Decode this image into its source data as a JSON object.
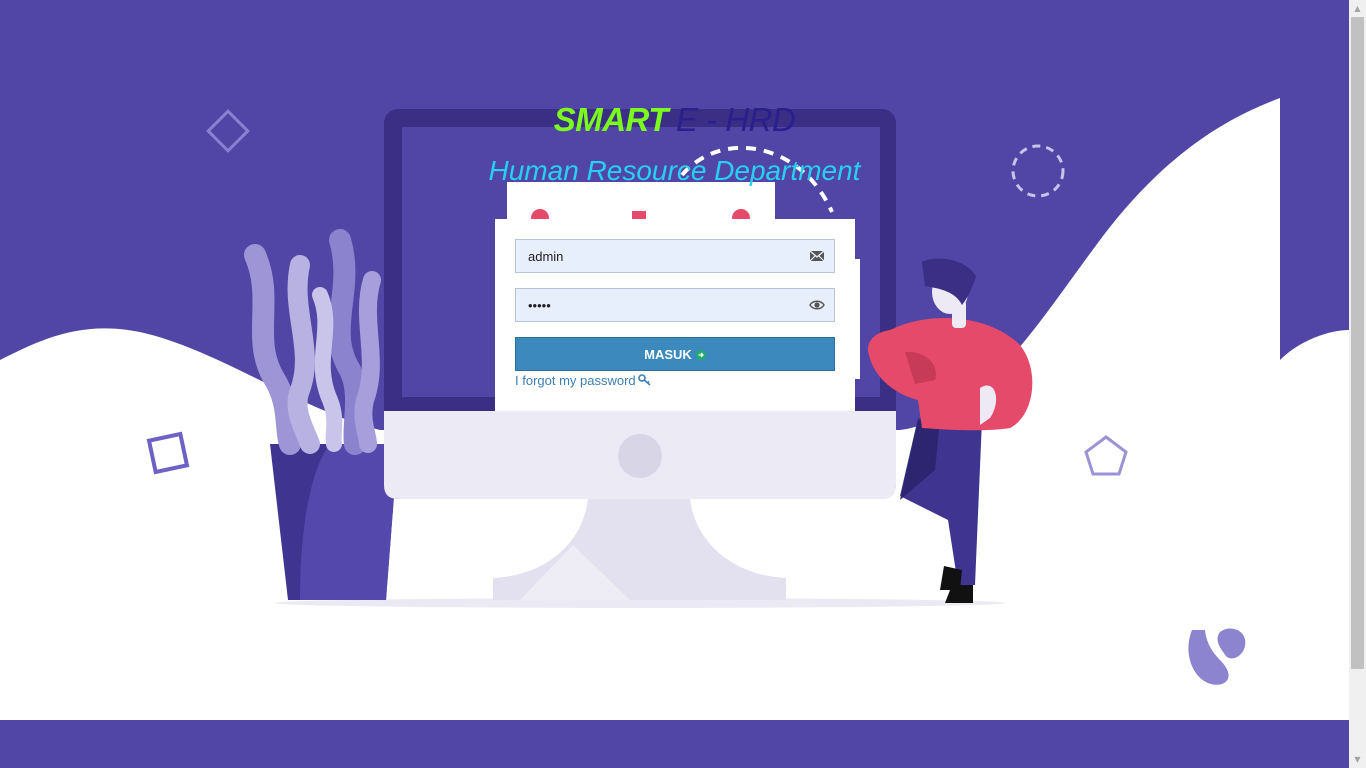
{
  "brand": {
    "strong": "SMART",
    "light": "E - HRD"
  },
  "tagline": "Human Resource Department",
  "login": {
    "username_value": "admin",
    "password_value": "*****",
    "submit_label": "MASUK",
    "forgot_label": "I forgot my password"
  },
  "icons": {
    "username": "envelope-icon",
    "password": "eye-icon",
    "submit": "arrow-right-icon",
    "forgot": "key-icon"
  },
  "colors": {
    "background": "#5146a6",
    "brand_strong": "#7cfc1e",
    "brand_light": "#2a1f8c",
    "tagline": "#27d0f0",
    "button": "#3b89bd",
    "link": "#3c7fb4",
    "input_bg": "#e8effc"
  }
}
